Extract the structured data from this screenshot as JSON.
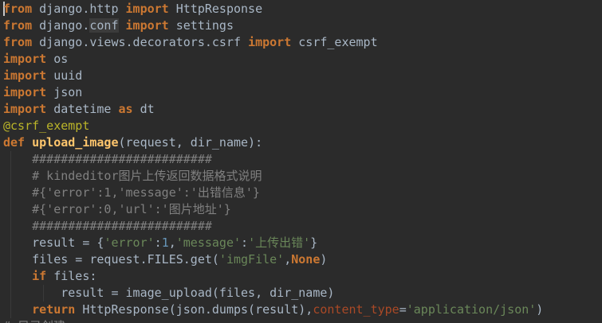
{
  "code_lines": [
    [
      [
        "kw",
        "from"
      ],
      [
        "txt",
        " django.http "
      ],
      [
        "kw",
        "import"
      ],
      [
        "txt",
        " HttpResponse"
      ]
    ],
    [
      [
        "kw",
        "from"
      ],
      [
        "txt",
        " django."
      ],
      [
        "hl",
        "conf"
      ],
      [
        "txt",
        " "
      ],
      [
        "kw",
        "import"
      ],
      [
        "txt",
        " settings"
      ]
    ],
    [
      [
        "kw",
        "from"
      ],
      [
        "txt",
        " django.views.decorators.csrf "
      ],
      [
        "kw",
        "import"
      ],
      [
        "txt",
        " csrf_exempt"
      ]
    ],
    [
      [
        "kw",
        "import"
      ],
      [
        "txt",
        " os"
      ]
    ],
    [
      [
        "kw",
        "import"
      ],
      [
        "txt",
        " uuid"
      ]
    ],
    [
      [
        "kw",
        "import"
      ],
      [
        "txt",
        " json"
      ]
    ],
    [
      [
        "kw",
        "import"
      ],
      [
        "txt",
        " datetime "
      ],
      [
        "kw",
        "as"
      ],
      [
        "txt",
        " dt"
      ]
    ],
    [
      [
        "deco",
        "@csrf_exempt"
      ]
    ],
    [
      [
        "kw",
        "def"
      ],
      [
        "txt",
        " "
      ],
      [
        "fn",
        "upload_image"
      ],
      [
        "txt",
        "(request"
      ],
      [
        "txt",
        ","
      ],
      [
        "txt",
        " dir_name):"
      ]
    ],
    [
      [
        "txt",
        "    "
      ],
      [
        "cm",
        "#########################"
      ]
    ],
    [
      [
        "txt",
        "    "
      ],
      [
        "cm",
        "# kindeditor图片上传返回数据格式说明"
      ]
    ],
    [
      [
        "txt",
        "    "
      ],
      [
        "cm",
        "#{'error':1,'message':'出错信息'}"
      ]
    ],
    [
      [
        "txt",
        "    "
      ],
      [
        "cm",
        "#{'error':0,'url':'图片地址'}"
      ]
    ],
    [
      [
        "txt",
        "    "
      ],
      [
        "cm",
        "#########################"
      ]
    ],
    [
      [
        "txt",
        "    result = {"
      ],
      [
        "str",
        "'error'"
      ],
      [
        "txt",
        ":"
      ],
      [
        "num",
        "1"
      ],
      [
        "txt",
        ","
      ],
      [
        "str",
        "'message'"
      ],
      [
        "txt",
        ":"
      ],
      [
        "str",
        "'上传出错'"
      ],
      [
        "txt",
        "}"
      ]
    ],
    [
      [
        "txt",
        "    files = request.FILES.get("
      ],
      [
        "str",
        "'imgFile'"
      ],
      [
        "txt",
        ","
      ],
      [
        "kw",
        "None"
      ],
      [
        "txt",
        ")"
      ]
    ],
    [
      [
        "txt",
        "    "
      ],
      [
        "kw",
        "if"
      ],
      [
        "txt",
        " files:"
      ]
    ],
    [
      [
        "txt",
        "        result = image_upload(files"
      ],
      [
        "txt",
        ","
      ],
      [
        "txt",
        " dir_name)"
      ]
    ],
    [
      [
        "txt",
        "    "
      ],
      [
        "kw",
        "return"
      ],
      [
        "txt",
        " HttpResponse(json.dumps(result)"
      ],
      [
        "txt",
        ","
      ],
      [
        "param",
        "content_type"
      ],
      [
        "txt",
        "="
      ],
      [
        "str",
        "'application/json'"
      ],
      [
        "txt",
        ")"
      ]
    ],
    [
      [
        "cm",
        "# 目录创建"
      ]
    ]
  ]
}
